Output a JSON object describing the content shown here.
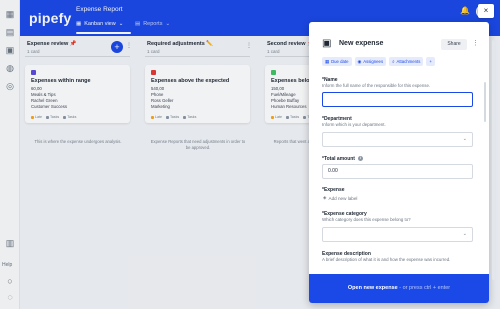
{
  "header": {
    "logo": "pipefy",
    "app_title": "Expense Report",
    "tabs": [
      {
        "label": "Kanban view",
        "icon": "kanban-icon"
      },
      {
        "label": "Reports",
        "icon": "reports-icon"
      }
    ],
    "accent": "#1b49e8"
  },
  "sidebar": {
    "help_label": "Help"
  },
  "columns": [
    {
      "title": "Expense review",
      "title_icon": "📌",
      "count": "1 card",
      "card": {
        "color": "#5b4bdb",
        "title": "Expenses within range",
        "lines": [
          "60,00",
          "Meals & Tips",
          "Rachel Green",
          "Customer Success"
        ],
        "tags": [
          "Late",
          "Tasks",
          "Tasks"
        ]
      },
      "description": "This is where the expense undergoes analysis."
    },
    {
      "title": "Required adjustments",
      "title_icon": "✏️",
      "count": "1 card",
      "card": {
        "color": "#e53935",
        "title": "Expenses above the expected",
        "lines": [
          "540,00",
          "Phone",
          "Ross Geller",
          "Marketing"
        ],
        "tags": [
          "Late",
          "Tasks",
          "Tasks"
        ]
      },
      "description": "Expense Reports that need adjustments in order to be approved."
    },
    {
      "title": "Second review",
      "title_icon": "📌",
      "count": "1 card",
      "card": {
        "color": "#43c463",
        "title": "Expenses below",
        "lines": [
          "150,00",
          "Fuel/Mileage",
          "Phoebe Buffay",
          "Human Resources"
        ],
        "tags": [
          "Late",
          "Tasks",
          "Tasks"
        ]
      },
      "description": "Reports that went adjustments need a second..."
    }
  ],
  "panel": {
    "title": "New expense",
    "share_label": "Share",
    "chips": [
      "Due date",
      "Assignees",
      "Attachments",
      "+"
    ],
    "fields": [
      {
        "label": "*Name",
        "help": "Inform the full name of the responsible for this expense.",
        "value": ""
      },
      {
        "label": "*Department",
        "help": "Inform which is your department.",
        "value": ""
      },
      {
        "label": "*Total amount",
        "help": "",
        "value": "0.00"
      },
      {
        "label": "*Expense",
        "help": "",
        "add_text": "Add new label"
      },
      {
        "label": "*Expense category",
        "help": "Which category does this expense belong to?",
        "value": ""
      },
      {
        "label": "Expense description",
        "help": "A brief description of what it is and how the expense was incurred.",
        "value": ""
      }
    ],
    "submit": {
      "label": "Open new expense",
      "hint": " - or press ctrl + enter"
    }
  }
}
